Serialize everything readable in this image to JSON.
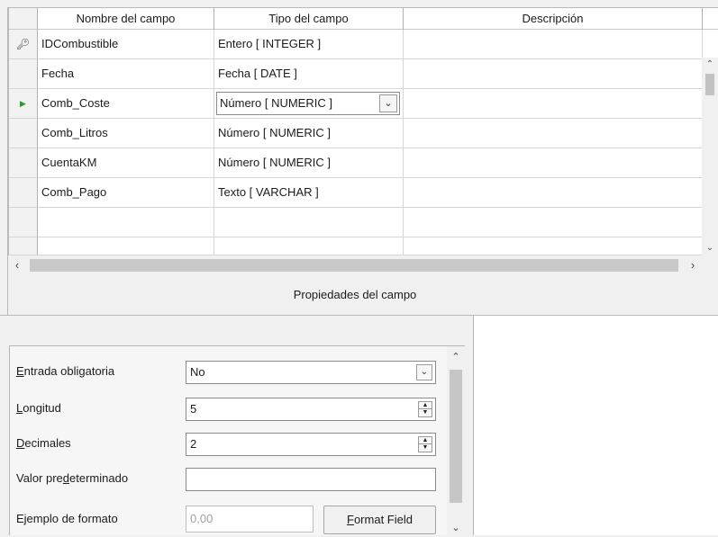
{
  "grid": {
    "headers": [
      "Nombre del campo",
      "Tipo del campo",
      "Descripción"
    ],
    "rows": [
      {
        "name": "IDCombustible",
        "type": "Entero [ INTEGER ]",
        "desc": ""
      },
      {
        "name": "Fecha",
        "type": "Fecha [ DATE ]",
        "desc": ""
      },
      {
        "name": "Comb_Coste",
        "type": "Número [ NUMERIC ]",
        "desc": ""
      },
      {
        "name": "Comb_Litros",
        "type": "Número [ NUMERIC ]",
        "desc": ""
      },
      {
        "name": "CuentaKM",
        "type": "Número [ NUMERIC ]",
        "desc": ""
      },
      {
        "name": "Comb_Pago",
        "type": "Texto [ VARCHAR ]",
        "desc": ""
      },
      {
        "name": "",
        "type": "",
        "desc": ""
      }
    ],
    "key_row": 0,
    "current_row": 2
  },
  "icons": {
    "key": "key-icon",
    "current_row": "current-row-arrow-icon",
    "dropdown": "chevron-down-icon",
    "scroll_up": "chevron-up-icon",
    "scroll_down": "chevron-down-icon",
    "scroll_left": "chevron-left-icon",
    "scroll_right": "chevron-right-icon"
  },
  "props_title": "Propiedades del campo",
  "properties": {
    "required": {
      "label_pre": "",
      "label_u": "E",
      "label_post": "ntrada obligatoria",
      "value": "No"
    },
    "length": {
      "label_pre": "",
      "label_u": "L",
      "label_post": "ongitud",
      "value": "5"
    },
    "decimals": {
      "label_pre": "",
      "label_u": "D",
      "label_post": "ecimales",
      "value": "2"
    },
    "default": {
      "label_pre": "Valor pre",
      "label_u": "d",
      "label_post": "eterminado",
      "value": ""
    },
    "format": {
      "label": "Ejemplo de formato",
      "value": "0,00",
      "button_u": "F",
      "button_post": "ormat Field"
    }
  },
  "colors": {
    "current_arrow": "#2b9a2b",
    "panel_bg": "#f0f0f0"
  }
}
